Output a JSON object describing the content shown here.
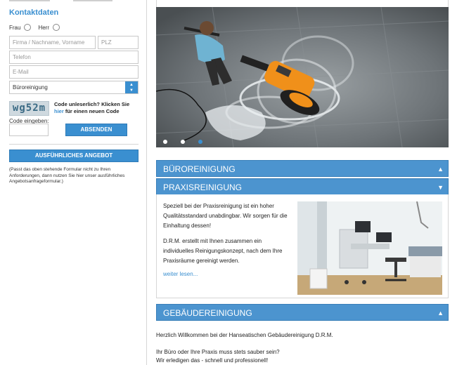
{
  "form": {
    "heading": "Kontaktdaten",
    "salutation_frau": "Frau",
    "salutation_herr": "Herr",
    "name_placeholder": "Firma / Nachname, Vorname",
    "zip_placeholder": "PLZ",
    "phone_placeholder": "Telefon",
    "email_placeholder": "E-Mail",
    "service_selected": "Büroreinigung",
    "captcha_code": "wg52m",
    "captcha_text_1": "Code unleserlich? Klicken Sie ",
    "captcha_link": "hier",
    "captcha_text_2": " für einen neuen Code",
    "code_label": "Code eingeben:",
    "send_button": "ABSENDEN",
    "offer_button": "AUSFÜHRLICHES ANGEBOT",
    "note": "(Passt das oben stehende Formular nicht zu Ihren Anforderungen, dann nutzen Sie hier unser ausführliches Angebotsanfrageformular.)"
  },
  "slider": {
    "active_index": 2,
    "dot_count": 3
  },
  "accordion": [
    {
      "title": "BÜROREINIGUNG",
      "state_icon": "triangle-up-icon"
    },
    {
      "title": "PRAXISREINIGUNG",
      "state_icon": "triangle-down-icon"
    },
    {
      "title": "GEBÄUDEREINIGUNG",
      "state_icon": "triangle-up-icon"
    }
  ],
  "praxis_panel": {
    "paragraph_1": "Speziell bei der Praxisreinigung ist ein hoher Qualitätsstandard unabdingbar. Wir sorgen für die Einhaltung dessen!",
    "paragraph_2": "D.R.M. erstellt mit Ihnen zusammen ein individuelles Reinigungskonzept, nach dem Ihre Praxisräume gereinigt werden.",
    "more_link": "weiter lesen..."
  },
  "welcome": {
    "line_1": "Herzlich Willkommen bei der Hanseatischen Gebäudereinigung D.R.M.",
    "line_2": "Ihr Büro oder Ihre Praxis muss stets sauber sein?",
    "line_3": "Wir erledigen das - schnell und professionell!"
  },
  "colors": {
    "accent": "#3a8fd0",
    "accordion_bg": "#4c94cf"
  }
}
